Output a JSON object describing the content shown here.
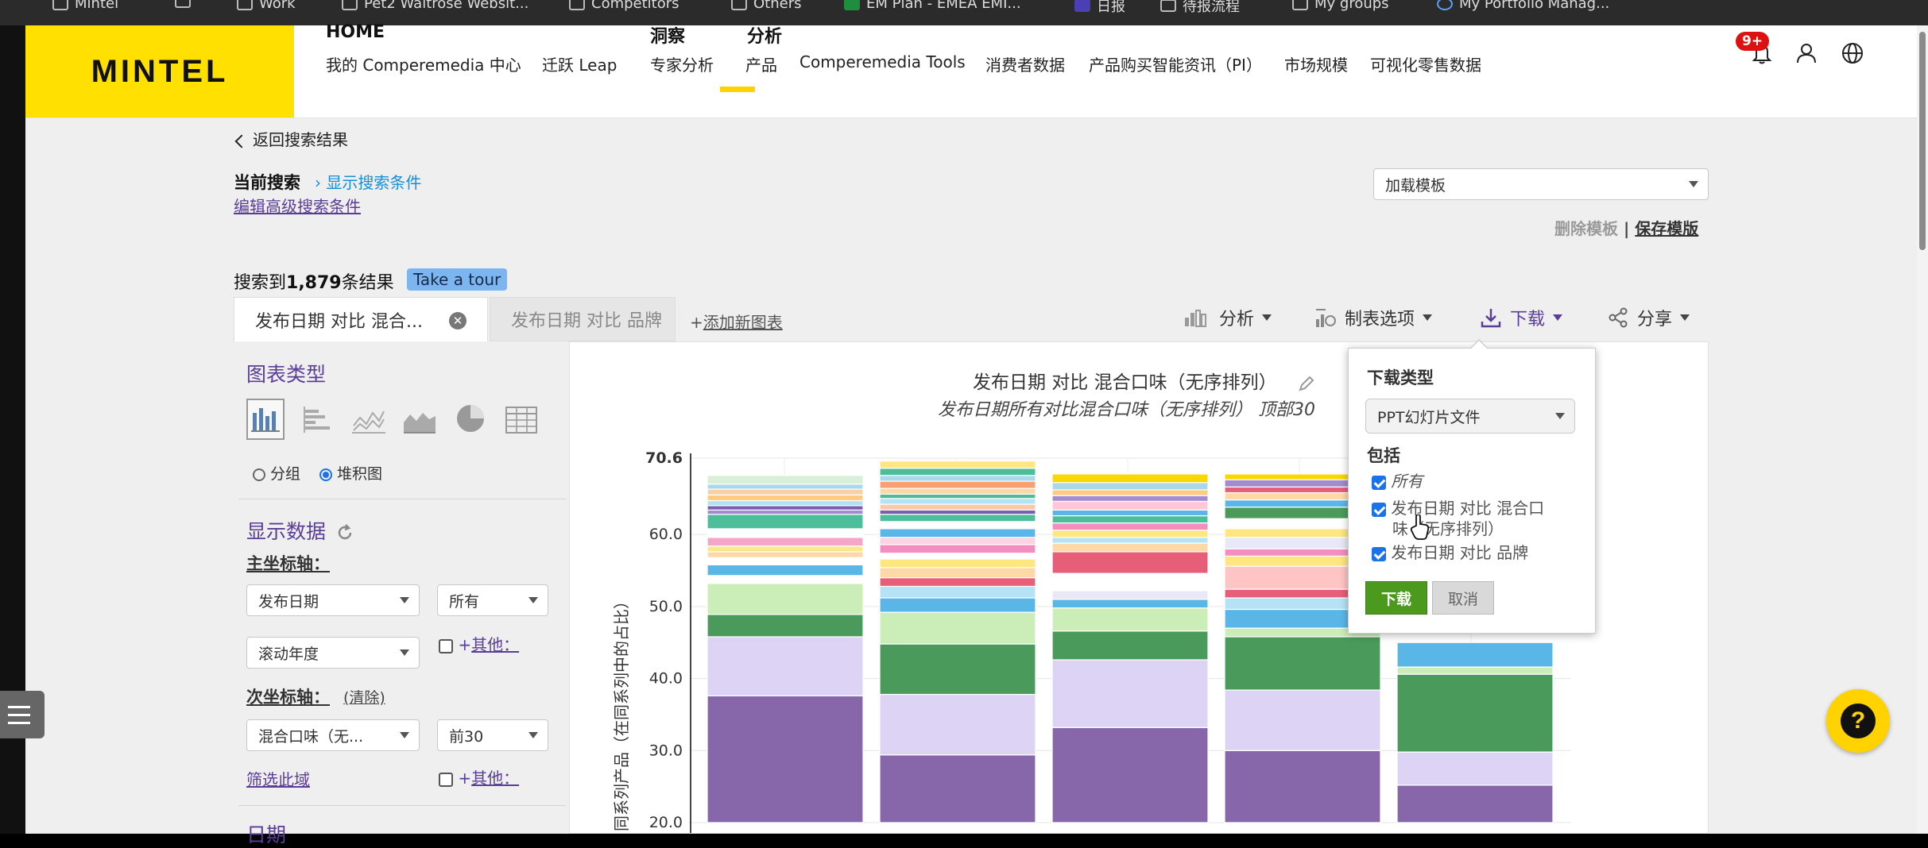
{
  "bookmarks": [
    {
      "label": "Mintel",
      "icon": "gear-icon"
    },
    {
      "label": "Work",
      "icon": "folder-icon"
    },
    {
      "label": "Pet2 Waitrose Websit...",
      "icon": "folder-icon"
    },
    {
      "label": "Competitors",
      "icon": "folder-icon"
    },
    {
      "label": "Others",
      "icon": "folder-icon"
    },
    {
      "label": "EM Plan - EMEA EMI...",
      "icon": "sheets-icon"
    },
    {
      "label": "日报",
      "icon": "app-icon"
    },
    {
      "label": "待报流程",
      "icon": "bookmark-icon"
    },
    {
      "label": "My groups",
      "icon": "chat-icon"
    },
    {
      "label": "My Portfolio Manag...",
      "icon": "globe-icon"
    }
  ],
  "header": {
    "logo": "MINTEL",
    "nav_top": {
      "home": "HOME",
      "insight": "洞察",
      "analysis": "分析"
    },
    "nav_sub": [
      "我的 Comperemedia 中心",
      "迁跃 Leap",
      "专家分析",
      "产品",
      "Comperemedia Tools",
      "消费者数据",
      "产品购买智能资讯（PI）",
      "市场规模",
      "可视化零售数据"
    ],
    "notifications_badge": "9+"
  },
  "back_link": "返回搜索结果",
  "current_search": {
    "label": "当前搜索",
    "show_conditions": "显示搜索条件",
    "edit_advanced": "编辑高级搜索条件"
  },
  "template": {
    "placeholder": "加载模板",
    "delete": "删除模板",
    "separator": "|",
    "save": "保存模版"
  },
  "results": {
    "prefix": "搜索到",
    "count": "1,879",
    "suffix": "条结果",
    "tour": "Take a tour"
  },
  "tabs": {
    "active": "发布日期 对比 混合...",
    "inactive": "发布日期 对比 品牌",
    "add": "+",
    "add_label": "添加新图表"
  },
  "toolbar": {
    "analysis": "分析",
    "table_options": "制表选项",
    "download": "下载",
    "share": "分享"
  },
  "left_panel": {
    "chart_type_title": "图表类型",
    "radio_group": "分组",
    "radio_stacked": "堆积图",
    "display_data_title": "显示数据",
    "primary_axis_label": "主坐标轴：",
    "primary_select_1": "发布日期",
    "primary_select_2": "所有",
    "primary_select_3": "滚动年度",
    "other_plus": "+",
    "other_label": "其他：",
    "secondary_axis_label": "次坐标轴：",
    "clear": "(清除)",
    "secondary_select_1": "混合口味（无...",
    "secondary_select_2": "前30",
    "filter_here": "筛选此域",
    "date_title": "日期"
  },
  "chart_data": {
    "type": "bar",
    "title": "发布日期 对比 混合口味（无序排列）",
    "subtitle": "发布日期所有对比混合口味（无序排列） 顶部30",
    "ylabel": "同系列产品（在同系列中的占比）",
    "yticks": [
      "70.6",
      "60.0",
      "50.0",
      "40.0",
      "30.0",
      "20.0"
    ],
    "ylim": [
      20,
      70.6
    ],
    "stacked": true,
    "bars": [
      {
        "top": 68.2,
        "segments": [
          [
            20,
            37.6,
            "#8767aa"
          ],
          [
            37.6,
            45.8,
            "#dcd3f5"
          ],
          [
            45.8,
            48.9,
            "#4a9a5c"
          ],
          [
            48.9,
            53.2,
            "#cbedb8"
          ],
          [
            53.2,
            54.3,
            "#ffffff"
          ],
          [
            54.3,
            55.8,
            "#5bb6e8"
          ],
          [
            55.8,
            56.8,
            "#ffffff"
          ],
          [
            56.8,
            57.6,
            "#ffd8a8"
          ],
          [
            57.6,
            58.4,
            "#fce88a"
          ],
          [
            58.4,
            59.6,
            "#f4a6c8"
          ],
          [
            59.6,
            60.8,
            "#ffffff"
          ],
          [
            60.8,
            62.8,
            "#4dbd9a"
          ],
          [
            62.8,
            63.4,
            "#a48bd0"
          ],
          [
            63.4,
            64.0,
            "#7a5fb0"
          ],
          [
            64.0,
            64.7,
            "#aee3f2"
          ],
          [
            64.7,
            65.5,
            "#ffcb80"
          ],
          [
            65.5,
            66.3,
            "#f8d0a4"
          ],
          [
            66.3,
            67.0,
            "#a8d8ea"
          ],
          [
            67.0,
            68.2,
            "#d8efd8"
          ]
        ]
      },
      {
        "top": 70.2,
        "segments": [
          [
            20,
            29.4,
            "#8767aa"
          ],
          [
            29.4,
            37.8,
            "#dcd3f5"
          ],
          [
            37.8,
            44.8,
            "#4a9a5c"
          ],
          [
            44.8,
            49.2,
            "#cbedb8"
          ],
          [
            49.2,
            51.2,
            "#5bb6e8"
          ],
          [
            51.2,
            52.8,
            "#b5e3f5"
          ],
          [
            52.8,
            54.0,
            "#e75e79"
          ],
          [
            54.0,
            55.4,
            "#ffd8a8"
          ],
          [
            55.4,
            56.6,
            "#ffe680"
          ],
          [
            56.6,
            57.4,
            "#ffffff"
          ],
          [
            57.4,
            58.6,
            "#f48ec0"
          ],
          [
            58.6,
            59.6,
            "#fbd4e4"
          ],
          [
            59.6,
            60.8,
            "#5bb6e8"
          ],
          [
            60.8,
            61.8,
            "#ffffff"
          ],
          [
            61.8,
            62.8,
            "#4dbd9a"
          ],
          [
            62.8,
            63.4,
            "#7a5fb0"
          ],
          [
            63.4,
            64.2,
            "#ffc8a8"
          ],
          [
            64.2,
            65.0,
            "#b5e3f5"
          ],
          [
            65.0,
            65.6,
            "#4dbd9a"
          ],
          [
            65.6,
            66.4,
            "#ffd8a8"
          ],
          [
            66.4,
            67.4,
            "#f8a070"
          ],
          [
            67.4,
            68.2,
            "#a8d8ea"
          ],
          [
            68.2,
            69.2,
            "#4dbd9a"
          ],
          [
            69.2,
            70.2,
            "#ffe680"
          ]
        ]
      },
      {
        "top": 68.4,
        "segments": [
          [
            20,
            33.2,
            "#8767aa"
          ],
          [
            33.2,
            42.6,
            "#dcd3f5"
          ],
          [
            42.6,
            46.6,
            "#4a9a5c"
          ],
          [
            46.6,
            49.8,
            "#cbedb8"
          ],
          [
            49.8,
            51.0,
            "#5bb6e8"
          ],
          [
            51.0,
            52.2,
            "#e8e8f8"
          ],
          [
            52.2,
            54.6,
            "#ffffff"
          ],
          [
            54.6,
            57.6,
            "#e75e79"
          ],
          [
            57.6,
            58.8,
            "#ffd8a8"
          ],
          [
            58.8,
            59.6,
            "#b5e3f5"
          ],
          [
            59.6,
            60.6,
            "#ffe680"
          ],
          [
            60.6,
            61.6,
            "#f48ec0"
          ],
          [
            61.6,
            62.6,
            "#4dbd9a"
          ],
          [
            62.6,
            63.4,
            "#5bb6e8"
          ],
          [
            63.4,
            64.6,
            "#ffc8d8"
          ],
          [
            64.6,
            65.4,
            "#a48bd0"
          ],
          [
            65.4,
            66.2,
            "#ffcb80"
          ],
          [
            66.2,
            67.2,
            "#a8d8ea"
          ],
          [
            67.2,
            68.4,
            "#f8d800"
          ]
        ]
      },
      {
        "top": 68.4,
        "segments": [
          [
            20,
            30.0,
            "#8767aa"
          ],
          [
            30.0,
            38.4,
            "#dcd3f5"
          ],
          [
            38.4,
            45.8,
            "#4a9a5c"
          ],
          [
            45.8,
            47.0,
            "#cbedb8"
          ],
          [
            47.0,
            49.6,
            "#5bb6e8"
          ],
          [
            49.6,
            51.2,
            "#b5e3f5"
          ],
          [
            51.2,
            52.4,
            "#e75e79"
          ],
          [
            52.4,
            55.6,
            "#ffc4c4"
          ],
          [
            55.6,
            57.0,
            "#ffe680"
          ],
          [
            57.0,
            58.0,
            "#f48ec0"
          ],
          [
            58.0,
            59.6,
            "#e8e8f8"
          ],
          [
            59.6,
            60.8,
            "#ffe680"
          ],
          [
            60.8,
            62.2,
            "#ffffff"
          ],
          [
            62.2,
            63.8,
            "#4a9a5c"
          ],
          [
            63.8,
            64.8,
            "#5bb6e8"
          ],
          [
            64.8,
            65.8,
            "#ffd8a8"
          ],
          [
            65.8,
            66.6,
            "#e75e79"
          ],
          [
            66.6,
            67.6,
            "#a48bd0"
          ],
          [
            67.6,
            68.4,
            "#f8d800"
          ]
        ]
      },
      {
        "top": 45.0,
        "segments": [
          [
            20,
            25.2,
            "#8767aa"
          ],
          [
            25.2,
            29.8,
            "#dcd3f5"
          ],
          [
            29.8,
            40.6,
            "#4a9a5c"
          ],
          [
            40.6,
            41.6,
            "#cbedb8"
          ],
          [
            41.6,
            45.0,
            "#5bb6e8"
          ]
        ]
      }
    ]
  },
  "download_popup": {
    "type_label": "下载类型",
    "type_value": "PPT幻灯片文件",
    "include_label": "包括",
    "opt_all": "所有",
    "opt_chart1_line1": "发布日期 对比 混合口",
    "opt_chart1_line2": "味（无序排列）",
    "opt_chart2": "发布日期 对比 品牌",
    "download_btn": "下载",
    "cancel_btn": "取消"
  }
}
